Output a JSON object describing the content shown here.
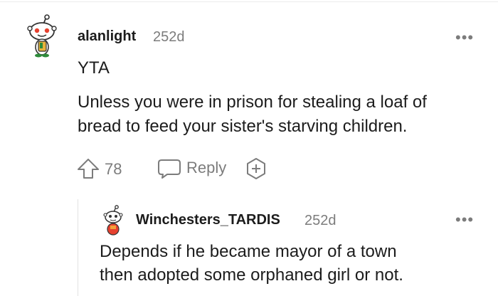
{
  "comment": {
    "author": "alanlight",
    "age": "252d",
    "lines": [
      "YTA",
      "Unless you were in prison for stealing a loaf of",
      "bread to feed your sister's starving children."
    ],
    "upvote_count": "78",
    "reply_label": "Reply",
    "more_label": "•••",
    "avatar_icon": "snoo-avatar-icon"
  },
  "reply": {
    "author": "Winchesters_TARDIS",
    "age": "252d",
    "lines": [
      "Depends if he became mayor of a town",
      "then adopted some orphaned girl or not."
    ],
    "more_label": "•••",
    "avatar_icon": "snoo-avatar-icon"
  },
  "colors": {
    "text": "#1c1c1c",
    "muted": "#7c7c7c",
    "snoo_red": "#e6412f",
    "snoo_green": "#2e8b3a"
  }
}
